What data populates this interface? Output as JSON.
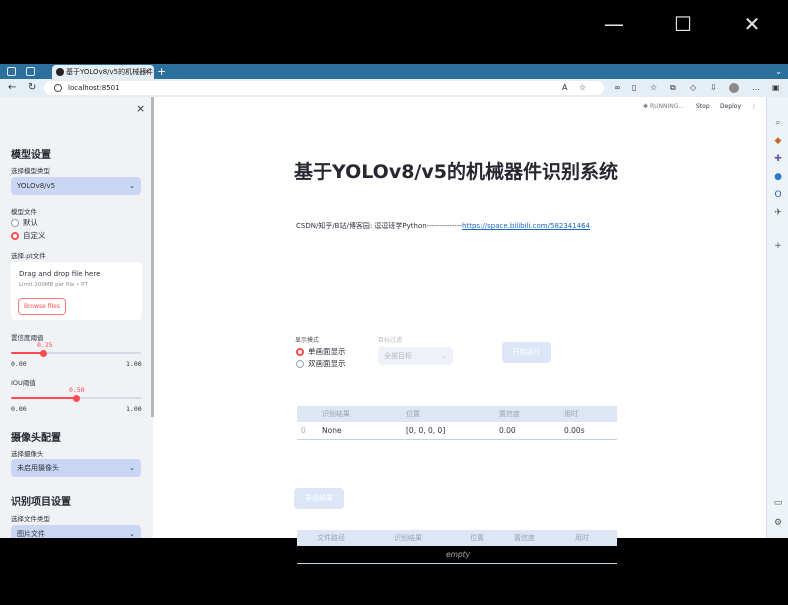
{
  "window": {
    "minimize": "—",
    "maximize": "☐",
    "close": "✕"
  },
  "browser": {
    "tab_title": "基于YOLOv8/v5的机械器件识别",
    "url": "localhost:8501",
    "new_tab": "+",
    "tab_close": "×"
  },
  "app_header": {
    "status": "RUNNING...",
    "stop": "Stop",
    "deploy": "Deploy",
    "menu": "⋮"
  },
  "sidebar": {
    "close": "×",
    "model_section": "模型设置",
    "model_type_label": "选择模型类型",
    "model_type_value": "YOLOv8/v5",
    "model_file_label": "模型文件",
    "model_file_options": [
      "默认",
      "自定义"
    ],
    "model_file_selected": 1,
    "pt_label": "选择.pt文件",
    "uploader_title": "Drag and drop file here",
    "uploader_sub": "Limit 200MB per file • PT",
    "browse_label": "Browse files",
    "conf_label": "置信度阈值",
    "conf_value": "0.25",
    "conf_fraction": 0.25,
    "conf_min": "0.00",
    "conf_max": "1.00",
    "iou_label": "IOU阈值",
    "iou_value": "0.50",
    "iou_fraction": 0.5,
    "iou_min": "0.00",
    "iou_max": "1.00",
    "camera_section": "摄像头配置",
    "camera_label": "选择摄像头",
    "camera_value": "未启用摄像头",
    "project_section": "识别项目设置",
    "filetype_label": "选择文件类型",
    "filetype_value": "图片文件"
  },
  "main": {
    "title": "基于YOLOv8/v5的机械器件识别系统",
    "info_prefix": "CSDN/知乎/B站/博客园:   逗逗班学Python--------------",
    "info_link": "https://space.bilibili.com/582341464",
    "display_mode_label": "显示模式",
    "display_options": [
      "单画面显示",
      "双画面显示"
    ],
    "display_selected": 0,
    "target_filter_label": "目标过滤",
    "target_filter_value": "全部目标",
    "start_button": "开始运行",
    "results_table": {
      "headers": [
        "识别结果",
        "位置",
        "置信度",
        "用时"
      ],
      "rows": [
        {
          "index": "0",
          "result": "None",
          "position": "[0, 0, 0, 0]",
          "confidence": "0.00",
          "time": "0.00s"
        }
      ]
    },
    "export_button": "导出结果",
    "files_table": {
      "headers": [
        "文件路径",
        "识别结果",
        "位置",
        "置信度",
        "用时"
      ],
      "empty": "empty"
    }
  }
}
